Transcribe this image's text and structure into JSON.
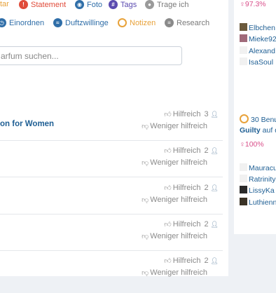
{
  "tabs_row1": [
    {
      "label": "tar",
      "icon": "",
      "color": "#e8a23a"
    },
    {
      "label": "Statement",
      "icon": "exclamation-icon",
      "color": "#e04b3a"
    },
    {
      "label": "Foto",
      "icon": "camera-icon",
      "color": "#2f6ea8"
    },
    {
      "label": "Tags",
      "icon": "hash-icon",
      "color": "#5b4bb0"
    },
    {
      "label": "Trage ich",
      "icon": "drop-icon",
      "color": "#8a8a8a"
    }
  ],
  "tabs_row2": [
    {
      "label": "Einordnen",
      "icon": "clock-icon",
      "color": "#2f6ea8"
    },
    {
      "label": "Duftzwillinge",
      "icon": "waves-icon",
      "color": "#2f6ea8"
    },
    {
      "label": "Notizen",
      "icon": "notes-icon",
      "color": "#e8a23a"
    },
    {
      "label": "Research",
      "icon": "database-icon",
      "color": "#8a8a8a"
    }
  ],
  "search": {
    "placeholder": "arfum suchen..."
  },
  "rows": [
    {
      "title": "on for Women",
      "helpful_label": "Hilfreich",
      "helpful_count": "3",
      "less_label": "Weniger hilfreich"
    },
    {
      "title": "",
      "helpful_label": "Hilfreich",
      "helpful_count": "2",
      "less_label": "Weniger hilfreich"
    },
    {
      "title": "",
      "helpful_label": "Hilfreich",
      "helpful_count": "2",
      "less_label": "Weniger hilfreich"
    },
    {
      "title": "",
      "helpful_label": "Hilfreich",
      "helpful_count": "2",
      "less_label": "Weniger hilfreich"
    },
    {
      "title": "",
      "helpful_label": "Hilfreich",
      "helpful_count": "2",
      "less_label": "Weniger hilfreich"
    }
  ],
  "sidebar": {
    "pct1": "♀97.3%",
    "users1": [
      "Elbchen",
      "Mieke92",
      "Alexand",
      "IsaSoul"
    ],
    "count_label": "30 Benu",
    "perfume_link": "Guilty",
    "perfume_suffix": " auf d",
    "pct2": "♀100%",
    "users2": [
      "Mauracu",
      "Ratrinity",
      "LissyKa",
      "Luthienn"
    ]
  }
}
